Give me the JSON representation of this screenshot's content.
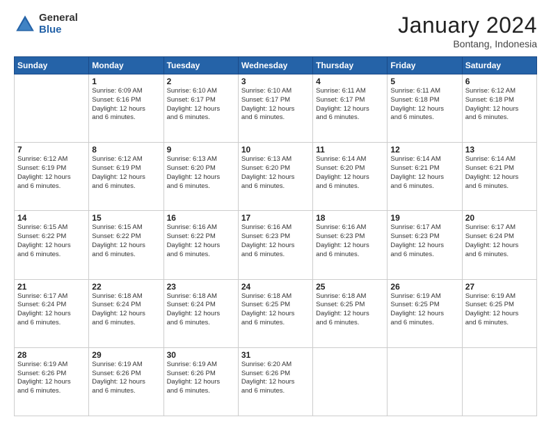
{
  "logo": {
    "general": "General",
    "blue": "Blue"
  },
  "header": {
    "month": "January 2024",
    "location": "Bontang, Indonesia"
  },
  "days_of_week": [
    "Sunday",
    "Monday",
    "Tuesday",
    "Wednesday",
    "Thursday",
    "Friday",
    "Saturday"
  ],
  "weeks": [
    [
      {
        "day": "",
        "info": ""
      },
      {
        "day": "1",
        "info": "Sunrise: 6:09 AM\nSunset: 6:16 PM\nDaylight: 12 hours\nand 6 minutes."
      },
      {
        "day": "2",
        "info": "Sunrise: 6:10 AM\nSunset: 6:17 PM\nDaylight: 12 hours\nand 6 minutes."
      },
      {
        "day": "3",
        "info": "Sunrise: 6:10 AM\nSunset: 6:17 PM\nDaylight: 12 hours\nand 6 minutes."
      },
      {
        "day": "4",
        "info": "Sunrise: 6:11 AM\nSunset: 6:17 PM\nDaylight: 12 hours\nand 6 minutes."
      },
      {
        "day": "5",
        "info": "Sunrise: 6:11 AM\nSunset: 6:18 PM\nDaylight: 12 hours\nand 6 minutes."
      },
      {
        "day": "6",
        "info": "Sunrise: 6:12 AM\nSunset: 6:18 PM\nDaylight: 12 hours\nand 6 minutes."
      }
    ],
    [
      {
        "day": "7",
        "info": "Sunrise: 6:12 AM\nSunset: 6:19 PM\nDaylight: 12 hours\nand 6 minutes."
      },
      {
        "day": "8",
        "info": "Sunrise: 6:12 AM\nSunset: 6:19 PM\nDaylight: 12 hours\nand 6 minutes."
      },
      {
        "day": "9",
        "info": "Sunrise: 6:13 AM\nSunset: 6:20 PM\nDaylight: 12 hours\nand 6 minutes."
      },
      {
        "day": "10",
        "info": "Sunrise: 6:13 AM\nSunset: 6:20 PM\nDaylight: 12 hours\nand 6 minutes."
      },
      {
        "day": "11",
        "info": "Sunrise: 6:14 AM\nSunset: 6:20 PM\nDaylight: 12 hours\nand 6 minutes."
      },
      {
        "day": "12",
        "info": "Sunrise: 6:14 AM\nSunset: 6:21 PM\nDaylight: 12 hours\nand 6 minutes."
      },
      {
        "day": "13",
        "info": "Sunrise: 6:14 AM\nSunset: 6:21 PM\nDaylight: 12 hours\nand 6 minutes."
      }
    ],
    [
      {
        "day": "14",
        "info": "Sunrise: 6:15 AM\nSunset: 6:22 PM\nDaylight: 12 hours\nand 6 minutes."
      },
      {
        "day": "15",
        "info": "Sunrise: 6:15 AM\nSunset: 6:22 PM\nDaylight: 12 hours\nand 6 minutes."
      },
      {
        "day": "16",
        "info": "Sunrise: 6:16 AM\nSunset: 6:22 PM\nDaylight: 12 hours\nand 6 minutes."
      },
      {
        "day": "17",
        "info": "Sunrise: 6:16 AM\nSunset: 6:23 PM\nDaylight: 12 hours\nand 6 minutes."
      },
      {
        "day": "18",
        "info": "Sunrise: 6:16 AM\nSunset: 6:23 PM\nDaylight: 12 hours\nand 6 minutes."
      },
      {
        "day": "19",
        "info": "Sunrise: 6:17 AM\nSunset: 6:23 PM\nDaylight: 12 hours\nand 6 minutes."
      },
      {
        "day": "20",
        "info": "Sunrise: 6:17 AM\nSunset: 6:24 PM\nDaylight: 12 hours\nand 6 minutes."
      }
    ],
    [
      {
        "day": "21",
        "info": "Sunrise: 6:17 AM\nSunset: 6:24 PM\nDaylight: 12 hours\nand 6 minutes."
      },
      {
        "day": "22",
        "info": "Sunrise: 6:18 AM\nSunset: 6:24 PM\nDaylight: 12 hours\nand 6 minutes."
      },
      {
        "day": "23",
        "info": "Sunrise: 6:18 AM\nSunset: 6:24 PM\nDaylight: 12 hours\nand 6 minutes."
      },
      {
        "day": "24",
        "info": "Sunrise: 6:18 AM\nSunset: 6:25 PM\nDaylight: 12 hours\nand 6 minutes."
      },
      {
        "day": "25",
        "info": "Sunrise: 6:18 AM\nSunset: 6:25 PM\nDaylight: 12 hours\nand 6 minutes."
      },
      {
        "day": "26",
        "info": "Sunrise: 6:19 AM\nSunset: 6:25 PM\nDaylight: 12 hours\nand 6 minutes."
      },
      {
        "day": "27",
        "info": "Sunrise: 6:19 AM\nSunset: 6:25 PM\nDaylight: 12 hours\nand 6 minutes."
      }
    ],
    [
      {
        "day": "28",
        "info": "Sunrise: 6:19 AM\nSunset: 6:26 PM\nDaylight: 12 hours\nand 6 minutes."
      },
      {
        "day": "29",
        "info": "Sunrise: 6:19 AM\nSunset: 6:26 PM\nDaylight: 12 hours\nand 6 minutes."
      },
      {
        "day": "30",
        "info": "Sunrise: 6:19 AM\nSunset: 6:26 PM\nDaylight: 12 hours\nand 6 minutes."
      },
      {
        "day": "31",
        "info": "Sunrise: 6:20 AM\nSunset: 6:26 PM\nDaylight: 12 hours\nand 6 minutes."
      },
      {
        "day": "",
        "info": ""
      },
      {
        "day": "",
        "info": ""
      },
      {
        "day": "",
        "info": ""
      }
    ]
  ]
}
